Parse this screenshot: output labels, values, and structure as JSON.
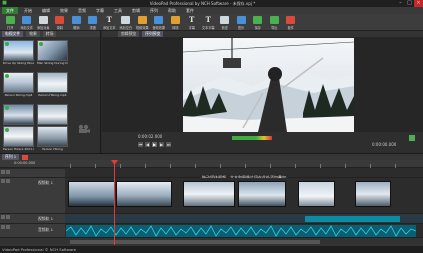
{
  "window": {
    "title": "VideoPad Professional by NCH Software - 未保存.vpj *"
  },
  "menu": [
    "文件",
    "开始",
    "编辑",
    "效果",
    "音频",
    "字幕",
    "工具",
    "剪辑",
    "序列",
    "帮助",
    "套件"
  ],
  "toolbar": [
    {
      "label": "打开",
      "icon": "open-icon"
    },
    {
      "label": "添加文件",
      "icon": "add-files-icon"
    },
    {
      "label": "添加对象",
      "icon": "add-objects-icon"
    },
    {
      "label": "录制",
      "icon": "record-icon"
    },
    {
      "label": "撤销",
      "icon": "undo-icon"
    },
    {
      "label": "重做",
      "icon": "redo-icon"
    },
    {
      "label": "添加文本",
      "icon": "text-icon"
    },
    {
      "label": "添加空白",
      "icon": "blank-icon"
    },
    {
      "label": "视频效果",
      "icon": "video-effects-icon"
    },
    {
      "label": "音频效果",
      "icon": "audio-effects-icon"
    },
    {
      "label": "转场",
      "icon": "transition-icon"
    },
    {
      "label": "字幕",
      "icon": "subtitle-icon"
    },
    {
      "label": "文本字幕",
      "icon": "text-caption-icon"
    },
    {
      "label": "叙述",
      "icon": "narrate-icon"
    },
    {
      "label": "配乐",
      "icon": "soundtrack-icon"
    },
    {
      "label": "保存",
      "icon": "save-icon"
    },
    {
      "label": "导出",
      "icon": "export-icon"
    },
    {
      "label": "套件",
      "icon": "suite-icon"
    }
  ],
  "bin": {
    "tabs": [
      "电视文件",
      "效果",
      "转场"
    ],
    "clips": [
      {
        "caption": "Drive Up Skiing Mountains..."
      },
      {
        "caption": "Man Skiing During Daytime.mp4"
      },
      {
        "caption": "Person Skiing.mp4"
      },
      {
        "caption": "Person Hiking.mp4"
      },
      {
        "caption": "Person Skiing (2).mp4"
      },
      {
        "caption": "Person Hikers 2021.mp4"
      },
      {
        "caption": "Person Hikers 2021.mp4"
      },
      {
        "caption": "Person Hiking"
      }
    ]
  },
  "preview": {
    "tabs": [
      "剪辑预览",
      "序列预览"
    ],
    "time_left": "0:00:02.000",
    "time_right": "0:00:00.000"
  },
  "timeline": {
    "tabs": [
      "序列 1"
    ],
    "ruler_start": "0:00:00.000",
    "hint": "拖动媒体视频、文本和图像片段在此处添加叠加",
    "tracks": {
      "video": "视频轨 1",
      "overlay": "视频轨 1",
      "audio": "音频轨 1"
    }
  },
  "status": {
    "text": "VideoPad Professional © NCH Software"
  }
}
